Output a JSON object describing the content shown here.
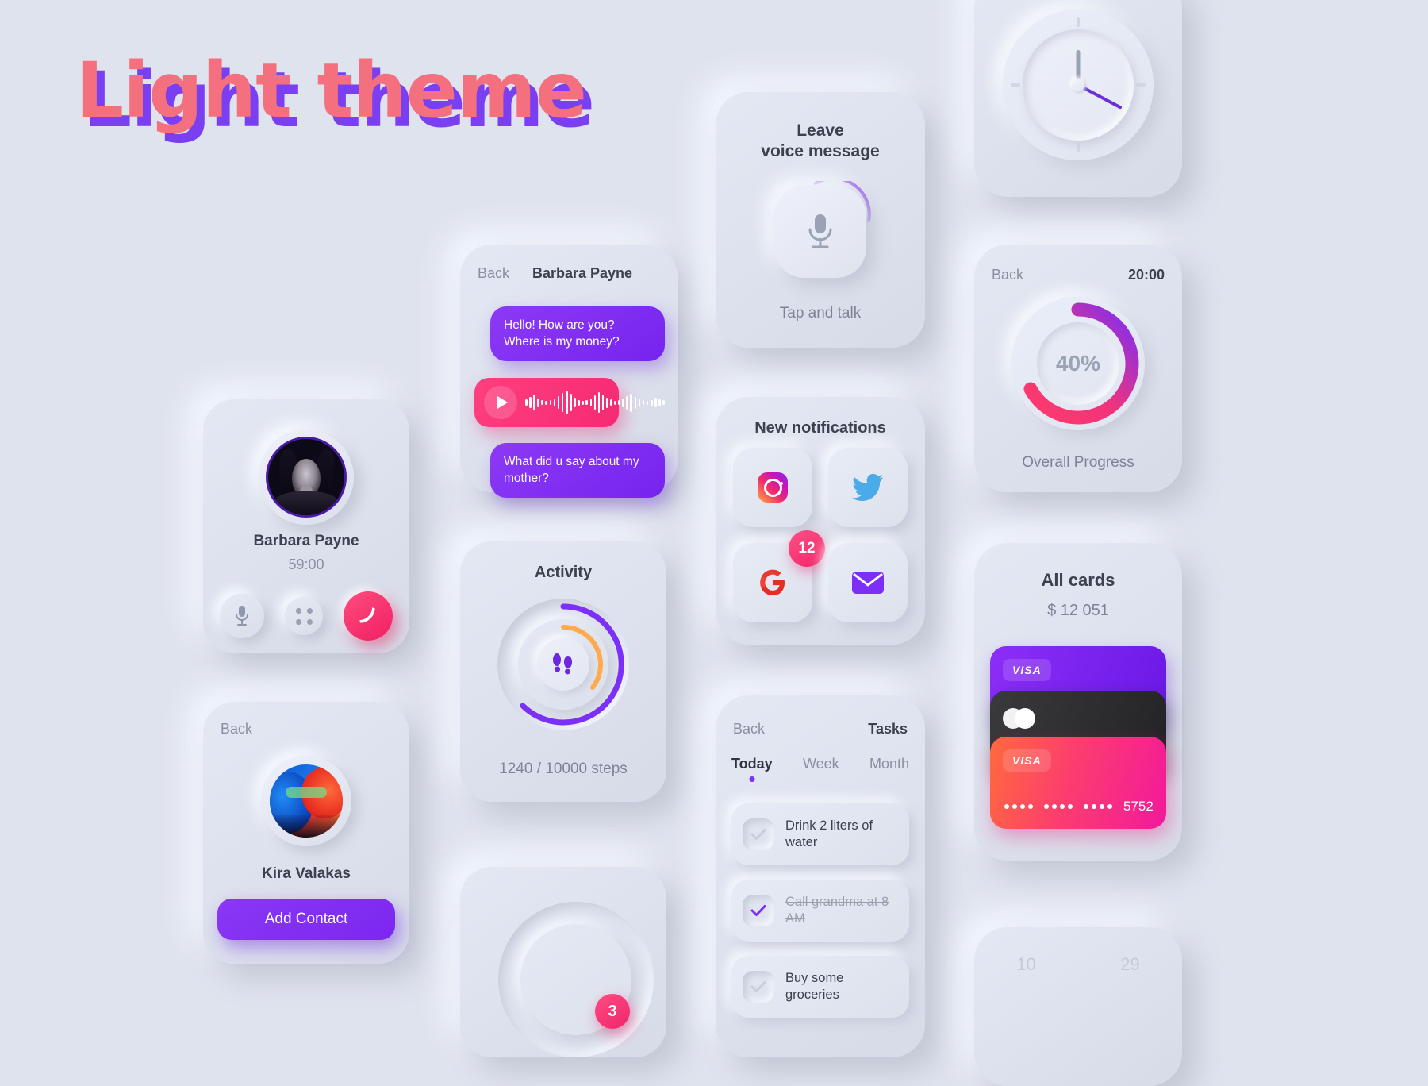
{
  "page": {
    "title": "Light theme",
    "background_color": "#dfe3ee",
    "accent_purple": "#7b2ff7",
    "accent_pink": "#f2376a"
  },
  "call_card": {
    "name": "Barbara Payne",
    "duration": "59:00",
    "buttons": [
      {
        "name": "mute-button",
        "icon": "microphone-icon"
      },
      {
        "name": "keypad-button",
        "icon": "keypad-dots-icon"
      },
      {
        "name": "end-call-button",
        "icon": "phone-hangup-icon"
      }
    ]
  },
  "contact_card": {
    "back_label": "Back",
    "name": "Kira Valakas",
    "add_button_label": "Add Contact"
  },
  "chat_card": {
    "back_label": "Back",
    "title": "Barbara Payne",
    "messages": [
      {
        "type": "text",
        "text": "Hello! How are you? Where is my money?"
      },
      {
        "type": "voice",
        "icon": "play-icon"
      },
      {
        "type": "text",
        "text": "What did u say about my mother?"
      }
    ]
  },
  "activity_card": {
    "title": "Activity",
    "caption": "1240 / 10000 steps",
    "icon": "footsteps-icon"
  },
  "ring_card": {
    "badge": "3"
  },
  "voice_card": {
    "title": "Leave\nvoice message",
    "title_line1": "Leave",
    "title_line2": "voice message",
    "caption": "Tap and talk",
    "icon": "microphone-icon"
  },
  "notifications_card": {
    "title": "New notifications",
    "tiles": [
      {
        "name": "instagram-icon",
        "badge": ""
      },
      {
        "name": "twitter-icon",
        "badge": ""
      },
      {
        "name": "google-icon",
        "badge": "12"
      },
      {
        "name": "mail-icon",
        "badge": ""
      }
    ]
  },
  "tasks_card": {
    "back_label": "Back",
    "title": "Tasks",
    "tabs": [
      {
        "label": "Today",
        "active": true
      },
      {
        "label": "Week",
        "active": false
      },
      {
        "label": "Month",
        "active": false
      }
    ],
    "items": [
      {
        "text": "Drink 2 liters of water",
        "done": false
      },
      {
        "text": "Call grandma at 8 AM",
        "done": true
      },
      {
        "text": "Buy some groceries",
        "done": false
      }
    ]
  },
  "clock_card": {
    "icon": "analog-clock-icon"
  },
  "progress_card": {
    "back_label": "Back",
    "time": "20:00",
    "percent": "40%",
    "caption": "Overall Progress"
  },
  "wallet_card": {
    "title": "All cards",
    "amount": "$ 12 051",
    "cards": [
      {
        "brand": "VISA",
        "color": "purple",
        "number": ""
      },
      {
        "brand": "mastercard",
        "color": "black",
        "number": ""
      },
      {
        "brand": "VISA",
        "color": "pink",
        "number": "5752"
      }
    ]
  },
  "calendar_card": {
    "numbers": [
      "10",
      "29"
    ]
  }
}
